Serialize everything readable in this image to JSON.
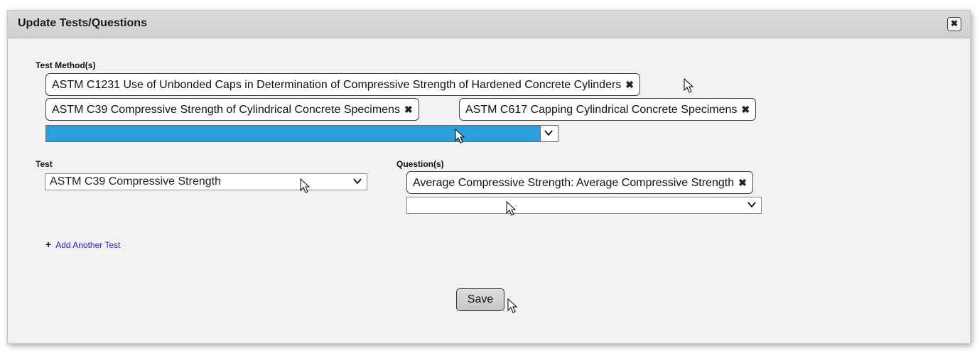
{
  "dialog": {
    "title": "Update Tests/Questions",
    "close_icon": "✖"
  },
  "test_methods": {
    "label": "Test Method(s)",
    "selected": [
      "ASTM C1231 Use of Unbonded Caps in Determination of Compressive Strength of Hardened Concrete Cylinders",
      "ASTM C39 Compressive Strength of Cylindrical Concrete Specimens",
      "ASTM C617 Capping Cylindrical Concrete Specimens"
    ],
    "dropdown_value": "",
    "remove_icon": "✖"
  },
  "test": {
    "label": "Test",
    "value": "ASTM C39 Compressive Strength"
  },
  "questions": {
    "label": "Question(s)",
    "selected": [
      "Average Compressive Strength: Average Compressive Strength"
    ],
    "dropdown_value": ""
  },
  "actions": {
    "add_another_test": "Add Another Test",
    "add_icon": "+",
    "save": "Save"
  },
  "colors": {
    "accent_blue": "#2d9fdc",
    "link": "#2222cc"
  }
}
